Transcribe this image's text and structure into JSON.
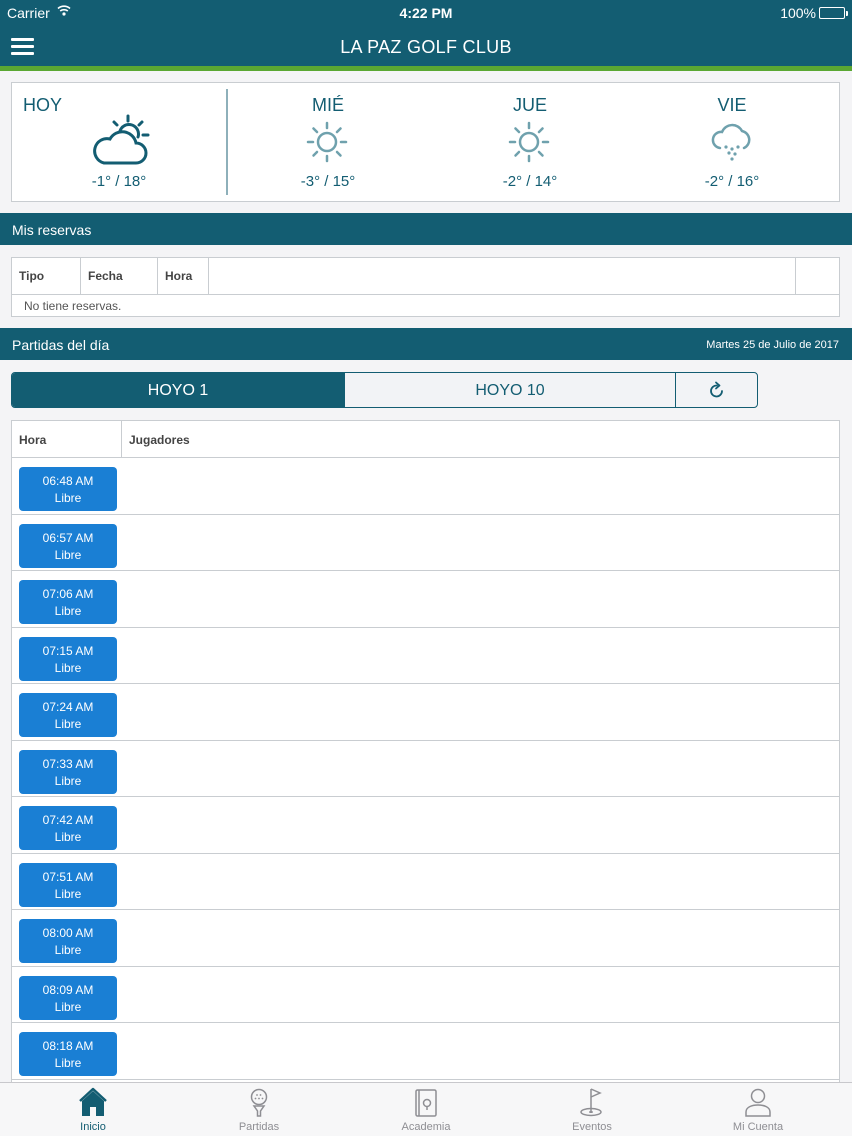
{
  "status_bar": {
    "carrier": "Carrier",
    "time": "4:22 PM",
    "battery": "100%"
  },
  "header": {
    "title": "LA PAZ GOLF CLUB"
  },
  "weather": [
    {
      "day": "HOY",
      "temp": "-1° / 18°",
      "icon": "partly-cloudy-icon"
    },
    {
      "day": "MIÉ",
      "temp": "-3° / 15°",
      "icon": "sun-icon"
    },
    {
      "day": "JUE",
      "temp": "-2° / 14°",
      "icon": "sun-icon"
    },
    {
      "day": "VIE",
      "temp": "-2° / 16°",
      "icon": "snow-cloud-icon"
    }
  ],
  "reservations": {
    "title": "Mis reservas",
    "columns": [
      "Tipo",
      "Fecha",
      "Hora"
    ],
    "empty_text": "No tiene reservas."
  },
  "matches": {
    "title": "Partidas del día",
    "date": "Martes 25 de Julio de 2017",
    "tabs": [
      "HOYO 1",
      "HOYO 10"
    ],
    "active_tab": "HOYO 1",
    "refresh_icon": "refresh-icon",
    "columns": [
      "Hora",
      "Jugadores"
    ],
    "slots": [
      {
        "time": "06:48 AM",
        "status": "Libre"
      },
      {
        "time": "06:57 AM",
        "status": "Libre"
      },
      {
        "time": "07:06 AM",
        "status": "Libre"
      },
      {
        "time": "07:15 AM",
        "status": "Libre"
      },
      {
        "time": "07:24 AM",
        "status": "Libre"
      },
      {
        "time": "07:33 AM",
        "status": "Libre"
      },
      {
        "time": "07:42 AM",
        "status": "Libre"
      },
      {
        "time": "07:51 AM",
        "status": "Libre"
      },
      {
        "time": "08:00 AM",
        "status": "Libre"
      },
      {
        "time": "08:09 AM",
        "status": "Libre"
      },
      {
        "time": "08:18 AM",
        "status": "Libre"
      }
    ]
  },
  "tabbar": [
    {
      "label": "Inicio",
      "icon": "home-icon",
      "active": true
    },
    {
      "label": "Partidas",
      "icon": "golf-tee-icon",
      "active": false
    },
    {
      "label": "Academia",
      "icon": "book-icon",
      "active": false
    },
    {
      "label": "Eventos",
      "icon": "golf-flag-icon",
      "active": false
    },
    {
      "label": "Mi Cuenta",
      "icon": "user-icon",
      "active": false
    }
  ],
  "colors": {
    "primary": "#135d72",
    "accent": "#5aa732",
    "slot_button": "#1a7fd4"
  }
}
